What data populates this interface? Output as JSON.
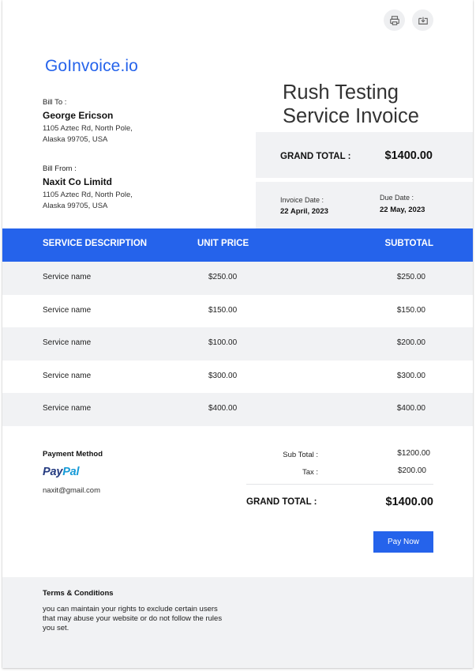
{
  "toolbar": {
    "print_icon": "printer-icon",
    "download_icon": "download-icon"
  },
  "brand": {
    "logo_text": "GoInvoice.io",
    "accent_color": "#2563eb"
  },
  "bill_to": {
    "label": "Bill To :",
    "name": "George Ericson",
    "address_line1": "1105 Aztec Rd, North Pole,",
    "address_line2": "Alaska 99705, USA"
  },
  "bill_from": {
    "label": "Bill From :",
    "name": "Naxit Co Limitd",
    "address_line1": "1105 Aztec Rd, North Pole,",
    "address_line2": "Alaska 99705, USA"
  },
  "invoice": {
    "title_line1": "Rush Testing",
    "title_line2": "Service Invoice",
    "grand_total_label": "GRAND TOTAL :",
    "grand_total_value": "$1400.00",
    "invoice_date_label": "Invoice Date :",
    "invoice_date_value": "22 April, 2023",
    "due_date_label": "Due Date :",
    "due_date_value": "22 May, 2023"
  },
  "table": {
    "headers": {
      "description": "SERVICE DESCRIPTION",
      "unit_price": "UNIT PRICE",
      "subtotal": "SUBTOTAL"
    },
    "rows": [
      {
        "description": "Service name",
        "unit_price": "$250.00",
        "subtotal": "$250.00"
      },
      {
        "description": "Service name",
        "unit_price": "$150.00",
        "subtotal": "$150.00"
      },
      {
        "description": "Service name",
        "unit_price": "$100.00",
        "subtotal": "$200.00"
      },
      {
        "description": "Service name",
        "unit_price": "$300.00",
        "subtotal": "$300.00"
      },
      {
        "description": "Service name",
        "unit_price": "$400.00",
        "subtotal": "$400.00"
      }
    ]
  },
  "payment": {
    "title": "Payment Method",
    "provider_part1": "Pay",
    "provider_part2": "Pal",
    "email": "naxit@gmail.com"
  },
  "summary": {
    "subtotal_label": "Sub Total :",
    "subtotal_value": "$1200.00",
    "tax_label": "Tax :",
    "tax_value": "$200.00",
    "grand_total_label": "GRAND TOTAL :",
    "grand_total_value": "$1400.00",
    "pay_button_label": "Pay Now"
  },
  "terms": {
    "title": "Terms & Conditions",
    "text": "you can maintain your rights to exclude certain users that may abuse your website or do not follow the rules you set."
  }
}
